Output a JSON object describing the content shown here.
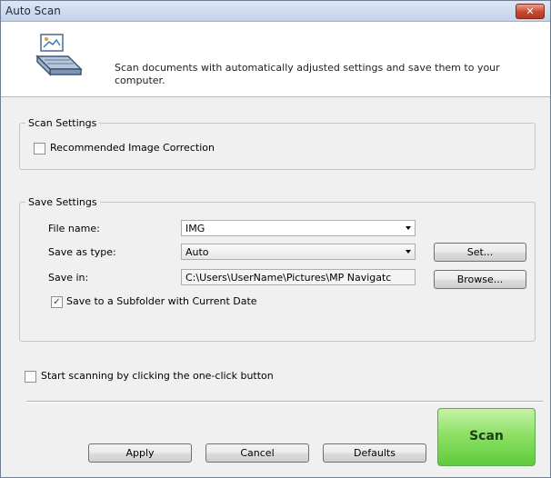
{
  "window": {
    "title": "Auto Scan",
    "close_glyph": "✕"
  },
  "header": {
    "icon": "scanner-document-icon",
    "description": "Scan documents with automatically adjusted settings and save them to your computer."
  },
  "scan_settings": {
    "legend": "Scan Settings",
    "recommended_image_correction": {
      "label": "Recommended Image Correction",
      "checked": false
    }
  },
  "save_settings": {
    "legend": "Save Settings",
    "file_name": {
      "label": "File name:",
      "value": "IMG"
    },
    "save_as_type": {
      "label": "Save as type:",
      "value": "Auto",
      "set_label": "Set..."
    },
    "save_in": {
      "label": "Save in:",
      "value": "C:\\Users\\UserName\\Pictures\\MP Navigatc",
      "browse_label": "Browse..."
    },
    "subfolder": {
      "label": "Save to a Subfolder with Current Date",
      "checked": true
    }
  },
  "one_click": {
    "label": "Start scanning by clicking the one-click button",
    "checked": false
  },
  "buttons": {
    "apply": "Apply",
    "cancel": "Cancel",
    "defaults": "Defaults",
    "scan": "Scan"
  },
  "colors": {
    "scan_button": "#7ed957",
    "close_button": "#c5462d",
    "title_bar": "#cfdcef"
  }
}
